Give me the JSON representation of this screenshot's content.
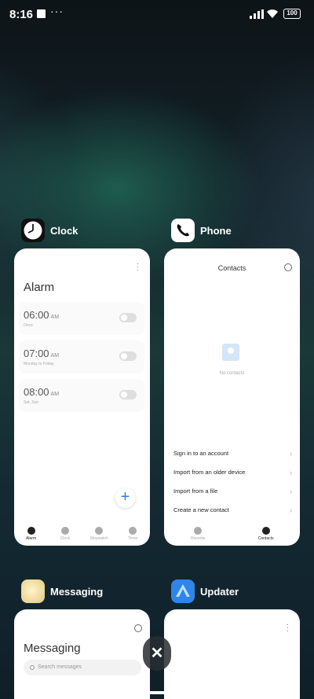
{
  "status": {
    "time": "8:16",
    "dots": "···",
    "battery": "100"
  },
  "cards": {
    "clock": {
      "app_name": "Clock",
      "title": "Alarm",
      "alarms": [
        {
          "time": "06:00",
          "ampm": "AM",
          "sub": "Once"
        },
        {
          "time": "07:00",
          "ampm": "AM",
          "sub": "Monday to Friday"
        },
        {
          "time": "08:00",
          "ampm": "AM",
          "sub": "Sat, Sun"
        }
      ],
      "fab": "+",
      "tabs": [
        {
          "label": "Alarm",
          "icon": "alarm-icon",
          "active": true
        },
        {
          "label": "Clock",
          "icon": "clock-icon",
          "active": false
        },
        {
          "label": "Stopwatch",
          "icon": "stopwatch-icon",
          "active": false
        },
        {
          "label": "Timer",
          "icon": "timer-icon",
          "active": false
        }
      ]
    },
    "phone": {
      "app_name": "Phone",
      "title": "Contacts",
      "empty_text": "No contacts",
      "options": [
        "Sign in to an account",
        "Import from an older device",
        "Import from a file",
        "Create a new contact"
      ],
      "tabs": [
        {
          "label": "Recents",
          "icon": "phone-icon",
          "active": false
        },
        {
          "label": "Contacts",
          "icon": "person-icon",
          "active": true
        }
      ]
    },
    "messaging": {
      "app_name": "Messaging",
      "title": "Messaging",
      "search_placeholder": "Search messages"
    },
    "updater": {
      "app_name": "Updater"
    }
  },
  "colors": {
    "accent": "#2f7de1",
    "phone_icon_bg": "#ffffff",
    "updater_icon_bg": "#2f86e8"
  }
}
